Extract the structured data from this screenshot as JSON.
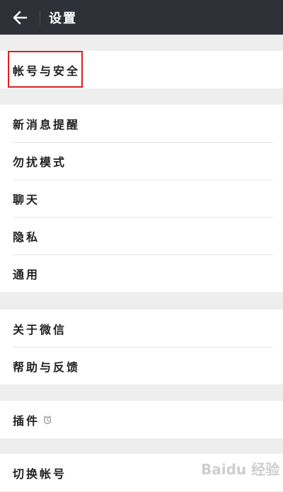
{
  "header": {
    "title": "设置"
  },
  "groups": [
    {
      "items": [
        {
          "label": "帐号与安全"
        }
      ]
    },
    {
      "items": [
        {
          "label": "新消息提醒"
        },
        {
          "label": "勿扰模式"
        },
        {
          "label": "聊天"
        },
        {
          "label": "隐私"
        },
        {
          "label": "通用"
        }
      ]
    },
    {
      "items": [
        {
          "label": "关于微信"
        },
        {
          "label": "帮助与反馈"
        }
      ]
    },
    {
      "items": [
        {
          "label": "插件"
        }
      ]
    },
    {
      "items": [
        {
          "label": "切换帐号"
        }
      ]
    }
  ],
  "colors": {
    "titlebar": "#2f3138",
    "highlight": "#e01e1e",
    "background": "#eeeeee"
  },
  "watermark": {
    "text": "Baidu 经验"
  }
}
